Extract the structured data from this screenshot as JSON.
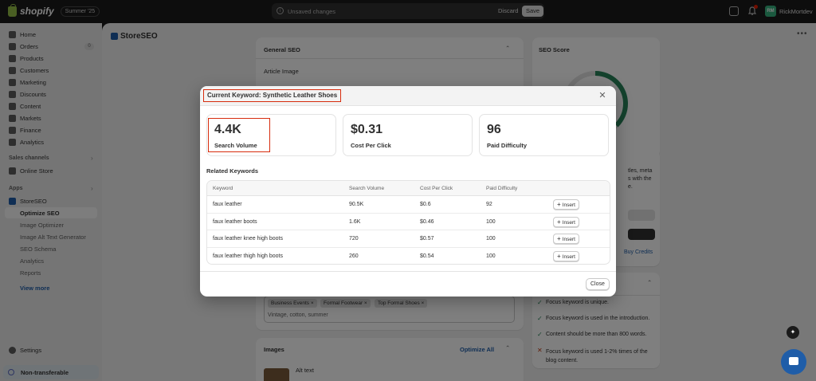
{
  "topbar": {
    "brand": "shopify",
    "edition": "Summer '25",
    "unsaved": "Unsaved changes",
    "discard": "Discard",
    "save": "Save",
    "user_initials": "RM",
    "user_name": "RickMortdev"
  },
  "sidebar": {
    "items": [
      {
        "label": "Home"
      },
      {
        "label": "Orders",
        "badge": "0"
      },
      {
        "label": "Products"
      },
      {
        "label": "Customers"
      },
      {
        "label": "Marketing"
      },
      {
        "label": "Discounts"
      },
      {
        "label": "Content"
      },
      {
        "label": "Markets"
      },
      {
        "label": "Finance"
      },
      {
        "label": "Analytics"
      }
    ],
    "sales_channels_label": "Sales channels",
    "online_store": "Online Store",
    "apps_label": "Apps",
    "app_name": "StoreSEO",
    "app_subitems": [
      "Optimize SEO",
      "Image Optimizer",
      "Image Alt Text Generator",
      "SEO Schema",
      "Analytics",
      "Reports"
    ],
    "view_more": "View more",
    "settings": "Settings",
    "non_transferable": "Non-transferable"
  },
  "main": {
    "app_title": "StoreSEO",
    "general_seo": "General SEO",
    "article_image": "Article Image",
    "tags": [
      "Business Events",
      "Formal Footwear",
      "Top Formal Shoes"
    ],
    "tags_placeholder": "Vintage, cotton, summer",
    "images_title": "Images",
    "optimize_all": "Optimize All",
    "alt_text": "Alt text",
    "seo_score": "SEO Score",
    "right_text_1": "tles, meta",
    "right_text_2": "s with the",
    "right_text_3": "e.",
    "buy_credits": "Buy Credits",
    "checks": [
      {
        "status": "pass",
        "text": "Focus keyword is unique."
      },
      {
        "status": "pass",
        "text": "Focus keyword is used in the introduction."
      },
      {
        "status": "pass",
        "text": "Content should be more than 800 words."
      },
      {
        "status": "fail",
        "text": "Focus keyword is used 1-2% times of the blog content."
      }
    ]
  },
  "modal": {
    "title": "Current Keyword: Synthetic Leather Shoes",
    "metrics": [
      {
        "value": "4.4K",
        "label": "Search Volume"
      },
      {
        "value": "$0.31",
        "label": "Cost Per Click"
      },
      {
        "value": "96",
        "label": "Paid Difficulty"
      }
    ],
    "related_title": "Related Keywords",
    "columns": [
      "Keyword",
      "Search Volume",
      "Cost Per Click",
      "Paid Difficulty"
    ],
    "rows": [
      {
        "keyword": "faux leather",
        "volume": "90.5K",
        "cpc": "$0.6",
        "difficulty": "92"
      },
      {
        "keyword": "faux leather boots",
        "volume": "1.6K",
        "cpc": "$0.46",
        "difficulty": "100"
      },
      {
        "keyword": "faux leather knee high boots",
        "volume": "720",
        "cpc": "$0.57",
        "difficulty": "100"
      },
      {
        "keyword": "faux leather thigh high boots",
        "volume": "260",
        "cpc": "$0.54",
        "difficulty": "100"
      }
    ],
    "insert_label": "Insert",
    "close_label": "Close"
  },
  "colors": {
    "accent": "#1f5da8",
    "highlight": "#d72c0d",
    "seo_ring": "#29845a"
  }
}
